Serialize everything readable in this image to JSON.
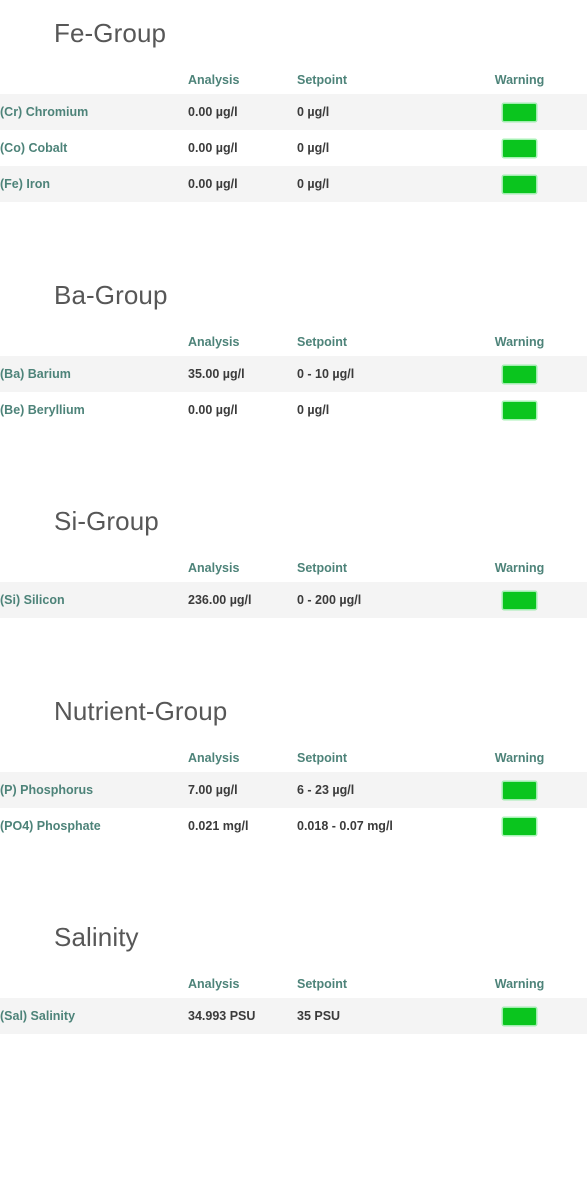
{
  "columns": {
    "name": "",
    "analysis": "Analysis",
    "setpoint": "Setpoint",
    "warning": "Warning"
  },
  "colors": {
    "accent_teal": "#4d8379",
    "title_gray": "#575757",
    "value_gray": "#3b3b3b",
    "row_stripe": "#f4f4f4",
    "status_green": "#0ac51e"
  },
  "sections": [
    {
      "title": "Fe-Group",
      "rows": [
        {
          "name": "(Cr) Chromium",
          "analysis": "0.00 µg/l",
          "setpoint": "0 µg/l",
          "status": "ok"
        },
        {
          "name": "(Co) Cobalt",
          "analysis": "0.00 µg/l",
          "setpoint": "0 µg/l",
          "status": "ok"
        },
        {
          "name": "(Fe) Iron",
          "analysis": "0.00 µg/l",
          "setpoint": "0 µg/l",
          "status": "ok"
        }
      ]
    },
    {
      "title": "Ba-Group",
      "rows": [
        {
          "name": "(Ba) Barium",
          "analysis": "35.00 µg/l",
          "setpoint": "0 - 10 µg/l",
          "status": "ok"
        },
        {
          "name": "(Be) Beryllium",
          "analysis": "0.00 µg/l",
          "setpoint": "0 µg/l",
          "status": "ok"
        }
      ]
    },
    {
      "title": "Si-Group",
      "rows": [
        {
          "name": "(Si) Silicon",
          "analysis": "236.00 µg/l",
          "setpoint": "0 - 200 µg/l",
          "status": "ok"
        }
      ]
    },
    {
      "title": "Nutrient-Group",
      "rows": [
        {
          "name": "(P) Phosphorus",
          "analysis": "7.00 µg/l",
          "setpoint": "6 - 23 µg/l",
          "status": "ok"
        },
        {
          "name": "(PO4) Phosphate",
          "analysis": "0.021 mg/l",
          "setpoint": "0.018 - 0.07 mg/l",
          "status": "ok"
        }
      ]
    },
    {
      "title": "Salinity",
      "rows": [
        {
          "name": "(Sal) Salinity",
          "analysis": "34.993 PSU",
          "setpoint": "35 PSU",
          "status": "ok"
        }
      ]
    }
  ]
}
